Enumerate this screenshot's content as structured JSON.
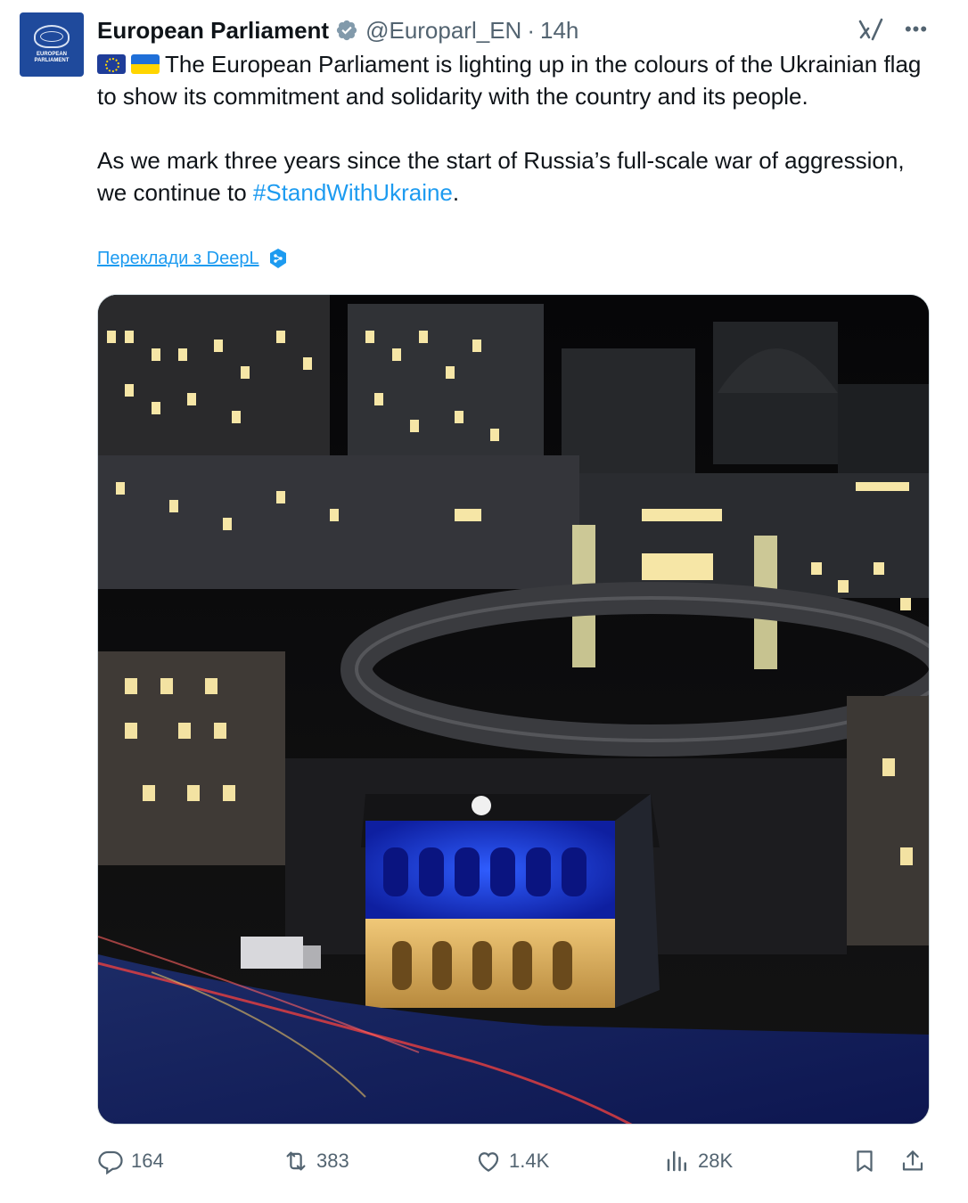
{
  "account": {
    "name": "European Parliament",
    "handle": "@Europarl_EN",
    "separator": "·",
    "time": "14h",
    "avatar_text": "EUROPEAN PARLIAMENT"
  },
  "tweet": {
    "paragraph1": "The European Parliament is lighting up in the colours of the Ukrainian flag to show its commitment and solidarity with the country and its people.",
    "paragraph2_prefix": "As we mark three years since the start of Russia’s full-scale war of aggression, we continue to ",
    "hashtag": "#StandWithUkraine",
    "paragraph2_suffix": ".",
    "translate_label": "Переклади з DeepL"
  },
  "media": {
    "description": "Night view of the European Parliament building lit in blue and yellow"
  },
  "actions": {
    "replies": "164",
    "reposts": "383",
    "likes": "1.4K",
    "views": "28K"
  },
  "colors": {
    "accent": "#1d9bf0",
    "secondary_text": "#536471",
    "primary_text": "#0f1419",
    "verified": "#829aab",
    "ukraine_blue": "#1f6fd8",
    "ukraine_yellow": "#ffd500"
  },
  "icons": [
    "verified-badge-icon",
    "grok-icon",
    "more-icon",
    "deepl-icon",
    "reply-icon",
    "repost-icon",
    "like-icon",
    "views-icon",
    "bookmark-icon",
    "share-icon"
  ]
}
